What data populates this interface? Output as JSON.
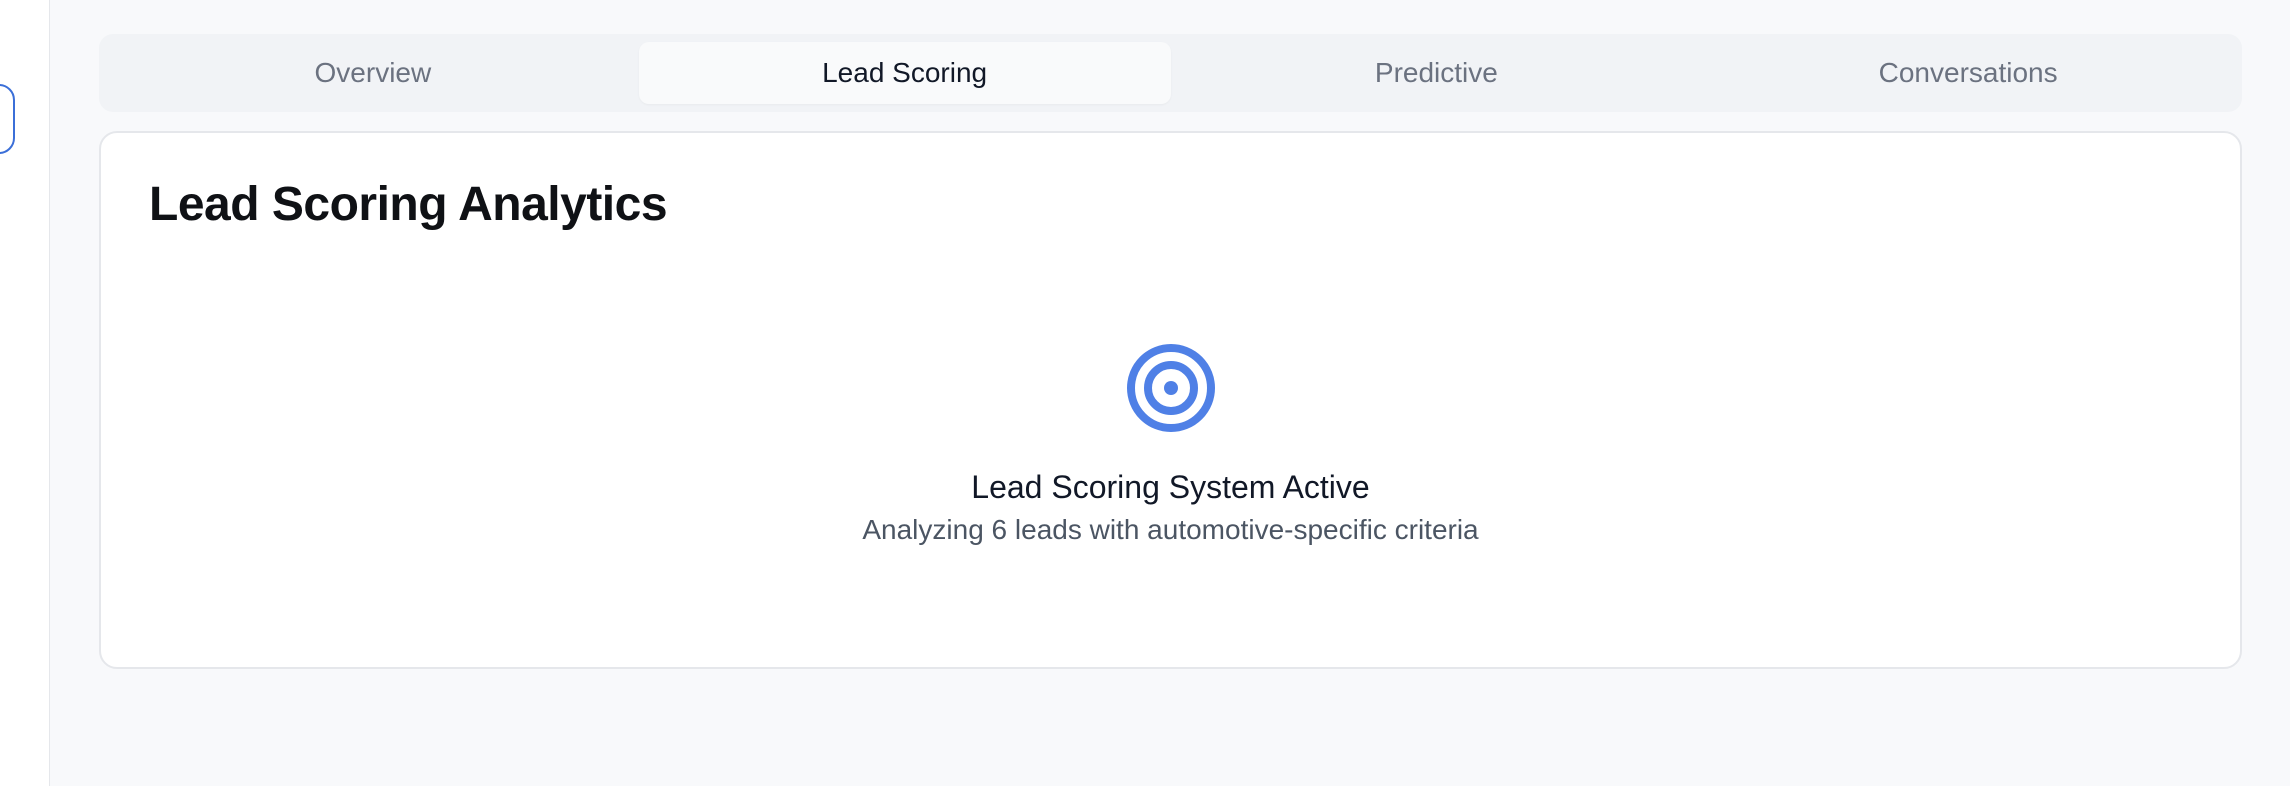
{
  "tabs": [
    {
      "label": "Overview",
      "active": false
    },
    {
      "label": "Lead Scoring",
      "active": true
    },
    {
      "label": "Predictive",
      "active": false
    },
    {
      "label": "Conversations",
      "active": false
    }
  ],
  "card": {
    "title": "Lead Scoring Analytics",
    "icon": "target-icon",
    "status_title": "Lead Scoring System Active",
    "status_subtitle": "Analyzing 6 leads with automotive-specific criteria"
  },
  "colors": {
    "accent": "#4f80e6",
    "background": "#f8f9fb",
    "tab_bar": "#f1f3f6",
    "card_border": "#e5e7eb"
  }
}
